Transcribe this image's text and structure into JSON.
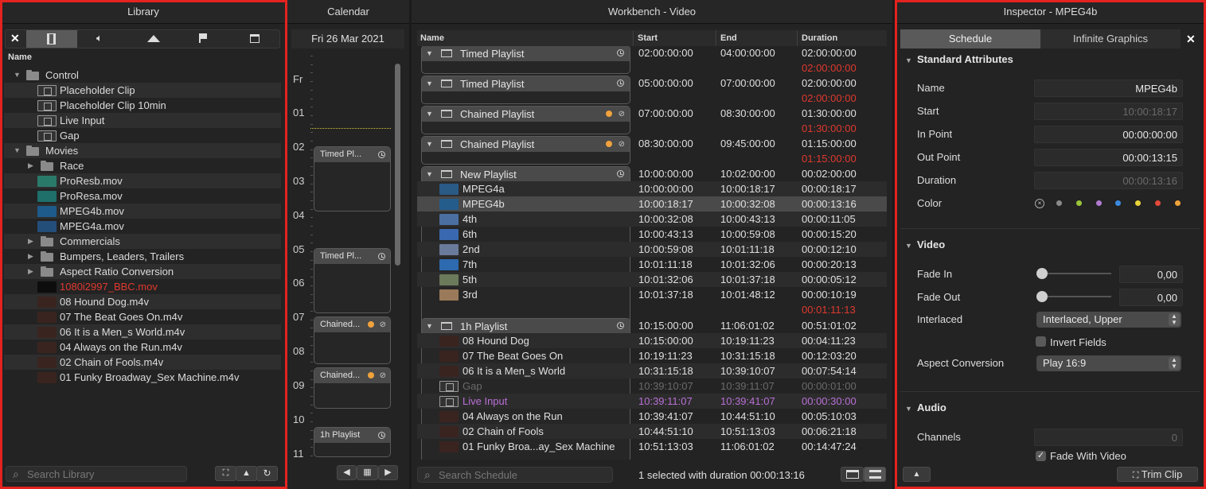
{
  "library": {
    "title": "Library",
    "tabs": [
      "close-icon",
      "film-icon",
      "speaker-icon",
      "mountains-icon",
      "flag-icon",
      "window-icon"
    ],
    "column": "Name",
    "items": [
      {
        "label": "Control",
        "type": "folder",
        "indent": 0,
        "open": true
      },
      {
        "label": "Placeholder Clip",
        "type": "film",
        "indent": 1
      },
      {
        "label": "Placeholder Clip 10min",
        "type": "film",
        "indent": 1
      },
      {
        "label": "Live Input",
        "type": "camera",
        "indent": 1
      },
      {
        "label": "Gap",
        "type": "gap",
        "indent": 1
      },
      {
        "label": "Movies",
        "type": "folder",
        "indent": 0,
        "open": true
      },
      {
        "label": "Race",
        "type": "folder",
        "indent": 1,
        "open": false
      },
      {
        "label": "ProResb.mov",
        "type": "thumb",
        "indent": 1,
        "color": "#2a7a6a"
      },
      {
        "label": "ProResa.mov",
        "type": "thumb",
        "indent": 1,
        "color": "#1f6f6a"
      },
      {
        "label": "MPEG4b.mov",
        "type": "thumb",
        "indent": 1,
        "color": "#1e5a8a"
      },
      {
        "label": "MPEG4a.mov",
        "type": "thumb",
        "indent": 1,
        "color": "#244e7a"
      },
      {
        "label": "Commercials",
        "type": "folder",
        "indent": 1,
        "open": false
      },
      {
        "label": "Bumpers, Leaders, Trailers",
        "type": "folder",
        "indent": 1,
        "open": false
      },
      {
        "label": "Aspect Ratio Conversion",
        "type": "folder",
        "indent": 1,
        "open": false
      },
      {
        "label": "1080i2997_BBC.mov",
        "type": "thumb",
        "indent": 1,
        "color": "#0d0d0d",
        "red": true
      },
      {
        "label": "08 Hound Dog.m4v",
        "type": "thumb",
        "indent": 1,
        "color": "#3a2420"
      },
      {
        "label": "07 The Beat Goes On.m4v",
        "type": "thumb",
        "indent": 1,
        "color": "#3a2420"
      },
      {
        "label": "06 It is a Men_s World.m4v",
        "type": "thumb",
        "indent": 1,
        "color": "#3a2420"
      },
      {
        "label": "04 Always on the Run.m4v",
        "type": "thumb",
        "indent": 1,
        "color": "#3a2420"
      },
      {
        "label": "02 Chain of Fools.m4v",
        "type": "thumb",
        "indent": 1,
        "color": "#3a2420"
      },
      {
        "label": "01 Funky Broadway_Sex Machine.m4v",
        "type": "thumb",
        "indent": 1,
        "color": "#3a2420"
      }
    ],
    "search_placeholder": "Search Library"
  },
  "calendar": {
    "title": "Calendar",
    "date": "Fri 26 Mar 2021",
    "day_label": "Fr",
    "hours": [
      "01",
      "02",
      "03",
      "04",
      "05",
      "06",
      "07",
      "08",
      "09",
      "10",
      "11"
    ],
    "events": [
      {
        "label": "Timed Pl...",
        "icon": "clock"
      },
      {
        "label": "Timed Pl...",
        "icon": "clock"
      },
      {
        "label": "Chained...",
        "icon": "chain"
      },
      {
        "label": "Chained...",
        "icon": "chain"
      },
      {
        "label": "1h Playlist",
        "icon": "clock"
      }
    ]
  },
  "workbench": {
    "title": "Workbench - Video",
    "columns": [
      "Name",
      "Start",
      "End",
      "Duration"
    ],
    "status": "1 selected with duration 00:00:13:16",
    "search_placeholder": "Search Schedule",
    "playlists": [
      {
        "name": "Timed Playlist",
        "icon": "clock",
        "start": "02:00:00:00",
        "end": "04:00:00:00",
        "duration": "02:00:00:00",
        "gap": "02:00:00:00"
      },
      {
        "name": "Timed Playlist",
        "icon": "clock",
        "start": "05:00:00:00",
        "end": "07:00:00:00",
        "duration": "02:00:00:00",
        "gap": "02:00:00:00"
      },
      {
        "name": "Chained Playlist",
        "icon": "chain",
        "start": "07:00:00:00",
        "end": "08:30:00:00",
        "duration": "01:30:00:00",
        "gap": "01:30:00:00"
      },
      {
        "name": "Chained Playlist",
        "icon": "chain",
        "start": "08:30:00:00",
        "end": "09:45:00:00",
        "duration": "01:15:00:00",
        "gap": "01:15:00:00"
      }
    ],
    "new_playlist": {
      "name": "New Playlist",
      "start": "10:00:00:00",
      "end": "10:02:00:00",
      "duration": "00:02:00:00",
      "gap": "00:01:11:13",
      "clips": [
        {
          "name": "MPEG4a",
          "start": "10:00:00:00",
          "end": "10:00:18:17",
          "duration": "00:00:18:17",
          "color": "#2a5a86"
        },
        {
          "name": "MPEG4b",
          "start": "10:00:18:17",
          "end": "10:00:32:08",
          "duration": "00:00:13:16",
          "color": "#245c8c",
          "selected": true
        },
        {
          "name": "4th",
          "start": "10:00:32:08",
          "end": "10:00:43:13",
          "duration": "00:00:11:05",
          "color": "#4a6fa0"
        },
        {
          "name": "6th",
          "start": "10:00:43:13",
          "end": "10:00:59:08",
          "duration": "00:00:15:20",
          "color": "#3a68b0"
        },
        {
          "name": "2nd",
          "start": "10:00:59:08",
          "end": "10:01:11:18",
          "duration": "00:00:12:10",
          "color": "#6a7a9a"
        },
        {
          "name": "7th",
          "start": "10:01:11:18",
          "end": "10:01:32:06",
          "duration": "00:00:20:13",
          "color": "#2d6ab0"
        },
        {
          "name": "5th",
          "start": "10:01:32:06",
          "end": "10:01:37:18",
          "duration": "00:00:05:12",
          "color": "#6b7a5a"
        },
        {
          "name": "3rd",
          "start": "10:01:37:18",
          "end": "10:01:48:12",
          "duration": "00:00:10:19",
          "color": "#9a7a5a"
        }
      ]
    },
    "hour_playlist": {
      "name": "1h Playlist",
      "start": "10:15:00:00",
      "end": "11:06:01:02",
      "duration": "00:51:01:02",
      "clips": [
        {
          "name": "08 Hound Dog",
          "start": "10:15:00:00",
          "end": "10:19:11:23",
          "duration": "00:04:11:23",
          "kind": "thumb"
        },
        {
          "name": "07 The Beat Goes On",
          "start": "10:19:11:23",
          "end": "10:31:15:18",
          "duration": "00:12:03:20",
          "kind": "thumb"
        },
        {
          "name": "06 It is a Men_s World",
          "start": "10:31:15:18",
          "end": "10:39:10:07",
          "duration": "00:07:54:14",
          "kind": "thumb"
        },
        {
          "name": "Gap",
          "start": "10:39:10:07",
          "end": "10:39:11:07",
          "duration": "00:00:01:00",
          "kind": "gap"
        },
        {
          "name": "Live Input",
          "start": "10:39:11:07",
          "end": "10:39:41:07",
          "duration": "00:00:30:00",
          "kind": "live"
        },
        {
          "name": "04 Always on the Run",
          "start": "10:39:41:07",
          "end": "10:44:51:10",
          "duration": "00:05:10:03",
          "kind": "thumb"
        },
        {
          "name": "02 Chain of Fools",
          "start": "10:44:51:10",
          "end": "10:51:13:03",
          "duration": "00:06:21:18",
          "kind": "thumb"
        },
        {
          "name": "01 Funky Broa...ay_Sex Machine",
          "start": "10:51:13:03",
          "end": "11:06:01:02",
          "duration": "00:14:47:24",
          "kind": "thumb"
        }
      ]
    }
  },
  "inspector": {
    "title": "Inspector - MPEG4b",
    "tabs": [
      "Schedule",
      "Infinite Graphics"
    ],
    "standard_title": "Standard Attributes",
    "fields": [
      {
        "label": "Name",
        "value": "MPEG4b",
        "dim": false
      },
      {
        "label": "Start",
        "value": "10:00:18:17",
        "dim": true
      },
      {
        "label": "In Point",
        "value": "00:00:00:00",
        "dim": false
      },
      {
        "label": "Out Point",
        "value": "00:00:13:15",
        "dim": false
      },
      {
        "label": "Duration",
        "value": "00:00:13:16",
        "dim": true
      }
    ],
    "color_label": "Color",
    "colors": [
      "#8a8a8a",
      "#9ac43a",
      "#b07ad0",
      "#3a8ae0",
      "#e8d23a",
      "#e24a3a",
      "#f0a23c"
    ],
    "video_title": "Video",
    "fade_in_label": "Fade In",
    "fade_in_value": "0,00",
    "fade_out_label": "Fade Out",
    "fade_out_value": "0,00",
    "interlaced_label": "Interlaced",
    "interlaced_value": "Interlaced, Upper",
    "invert_label": "Invert Fields",
    "aspect_label": "Aspect Conversion",
    "aspect_value": "Play 16:9",
    "audio_title": "Audio",
    "channels_label": "Channels",
    "channels_value": "0",
    "fade_video_label": "Fade With Video",
    "trim_label": "Trim Clip"
  }
}
